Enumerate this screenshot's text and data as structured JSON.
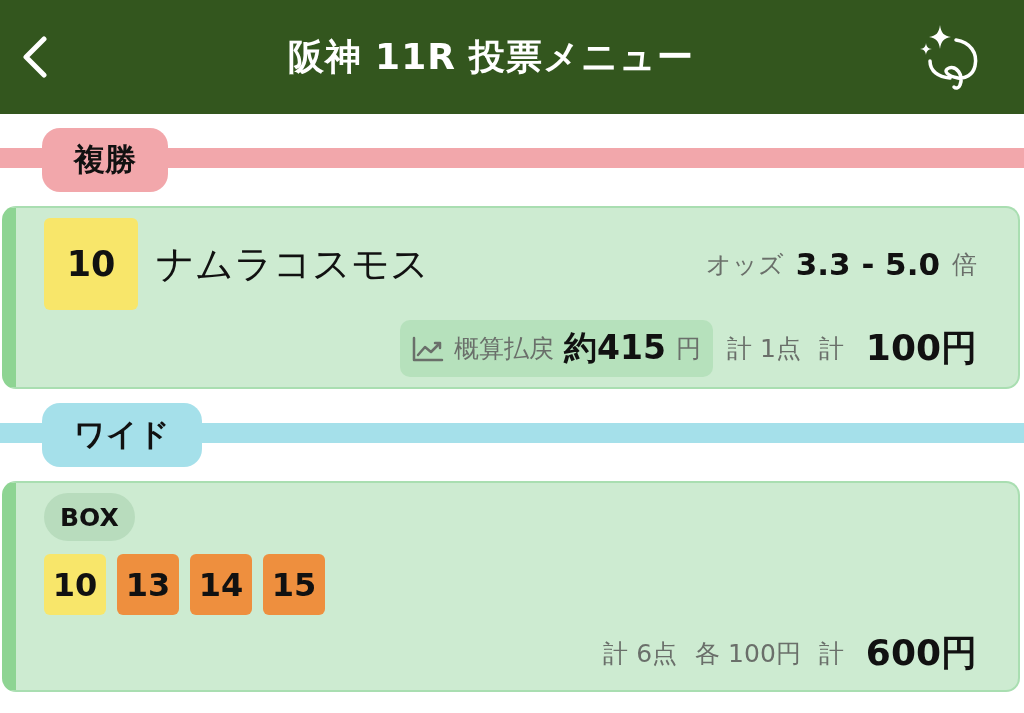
{
  "header": {
    "title": "阪神 11R 投票メニュー"
  },
  "bets": [
    {
      "kind": "single",
      "type_label": "複勝",
      "color": "#f2a7ab",
      "horse": {
        "number": "10",
        "color": "#f8e66a"
      },
      "horse_name": "ナムラコスモス",
      "odds_label": "オッズ",
      "odds": "3.3 - 5.0",
      "odds_unit": "倍",
      "payout_label": "概算払戻",
      "payout": "約415",
      "payout_unit": "円",
      "points": "計 1点",
      "total_label": "計",
      "total": "100円"
    },
    {
      "kind": "box",
      "type_label": "ワイド",
      "color": "#a5e0ea",
      "mode": "BOX",
      "horses": [
        {
          "number": "10",
          "color": "#f8e66a"
        },
        {
          "number": "13",
          "color": "#ee8f3e"
        },
        {
          "number": "14",
          "color": "#ee8f3e"
        },
        {
          "number": "15",
          "color": "#ee8f3e"
        }
      ],
      "points": "計 6点",
      "each": "各 100円",
      "total_label": "計",
      "total": "600円"
    }
  ]
}
